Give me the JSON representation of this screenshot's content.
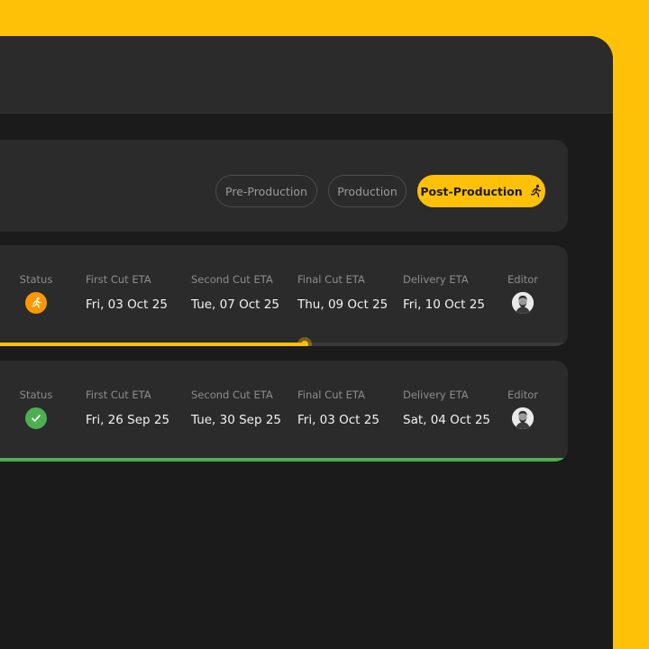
{
  "colors": {
    "accent": "#FFC107",
    "status_in_progress": "#FF9800",
    "status_done": "#4CAF50"
  },
  "filters": [
    {
      "label": "Pre-Production",
      "active": false
    },
    {
      "label": "Production",
      "active": false
    },
    {
      "label": "Post-Production",
      "active": true,
      "icon": "running-person-icon"
    }
  ],
  "rows": [
    {
      "status_label": "Status",
      "status_icon": "running-person-icon",
      "status_color": "#FF9800",
      "first_cut_label": "First Cut ETA",
      "first_cut": "Fri, 03 Oct 25",
      "second_cut_label": "Second Cut ETA",
      "second_cut": "Tue, 07 Oct 25",
      "final_cut_label": "Final Cut ETA",
      "final_cut": "Thu, 09 Oct 25",
      "delivery_label": "Delivery ETA",
      "delivery": "Fri, 10 Oct 25",
      "editor_label": "Editor",
      "editor_icon": "avatar-icon",
      "progress": 0.55,
      "progress_color": "#FFC107"
    },
    {
      "status_label": "Status",
      "status_icon": "checkmark-icon",
      "status_color": "#4CAF50",
      "first_cut_label": "First Cut ETA",
      "first_cut": "Fri, 26 Sep 25",
      "second_cut_label": "Second Cut ETA",
      "second_cut": "Tue, 30 Sep 25",
      "final_cut_label": "Final Cut ETA",
      "final_cut": "Fri, 03 Oct 25",
      "delivery_label": "Delivery ETA",
      "delivery": "Sat, 04 Oct 25",
      "editor_label": "Editor",
      "editor_icon": "avatar-icon",
      "progress": 1.0,
      "progress_color": "#4CAF50"
    }
  ]
}
